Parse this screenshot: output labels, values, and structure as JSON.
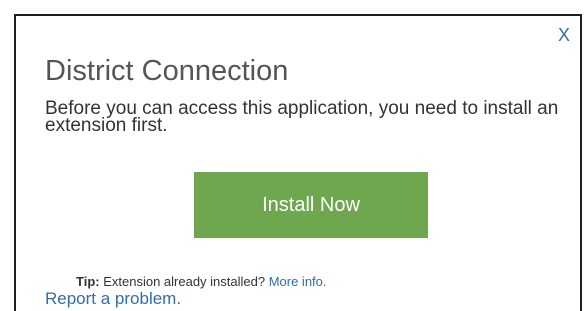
{
  "dialog": {
    "close_label": "X",
    "title": "District Connection",
    "message": "Before you can access this application, you need to install an extension first.",
    "install_button_label": "Install Now",
    "tip": {
      "label": "Tip:",
      "text": " Extension already installed? ",
      "link_text": "More info."
    },
    "report_link_text": "Report a problem."
  },
  "colors": {
    "install_button": "#6ea74d",
    "link": "#2f6fa8",
    "title": "#555555"
  }
}
